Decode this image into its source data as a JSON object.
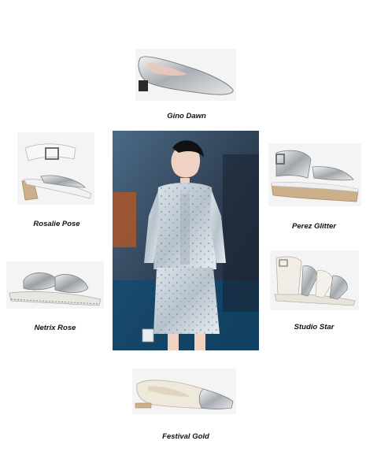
{
  "products": {
    "top": {
      "name": "Gino Dawn"
    },
    "left_upper": {
      "name": "Rosalie Pose"
    },
    "right_upper": {
      "name": "Perez Glitter"
    },
    "left_lower": {
      "name": "Netrix Rose"
    },
    "right_lower": {
      "name": "Studio Star"
    },
    "bottom": {
      "name": "Festival Gold"
    }
  },
  "model_photo": {
    "icon": "runway-model-photo"
  },
  "colors": {
    "metallic_silver": "#c8ccd0",
    "cream": "#ece6da",
    "tan_sole": "#cbb08a",
    "runway_bg": "#2b3b4e"
  }
}
